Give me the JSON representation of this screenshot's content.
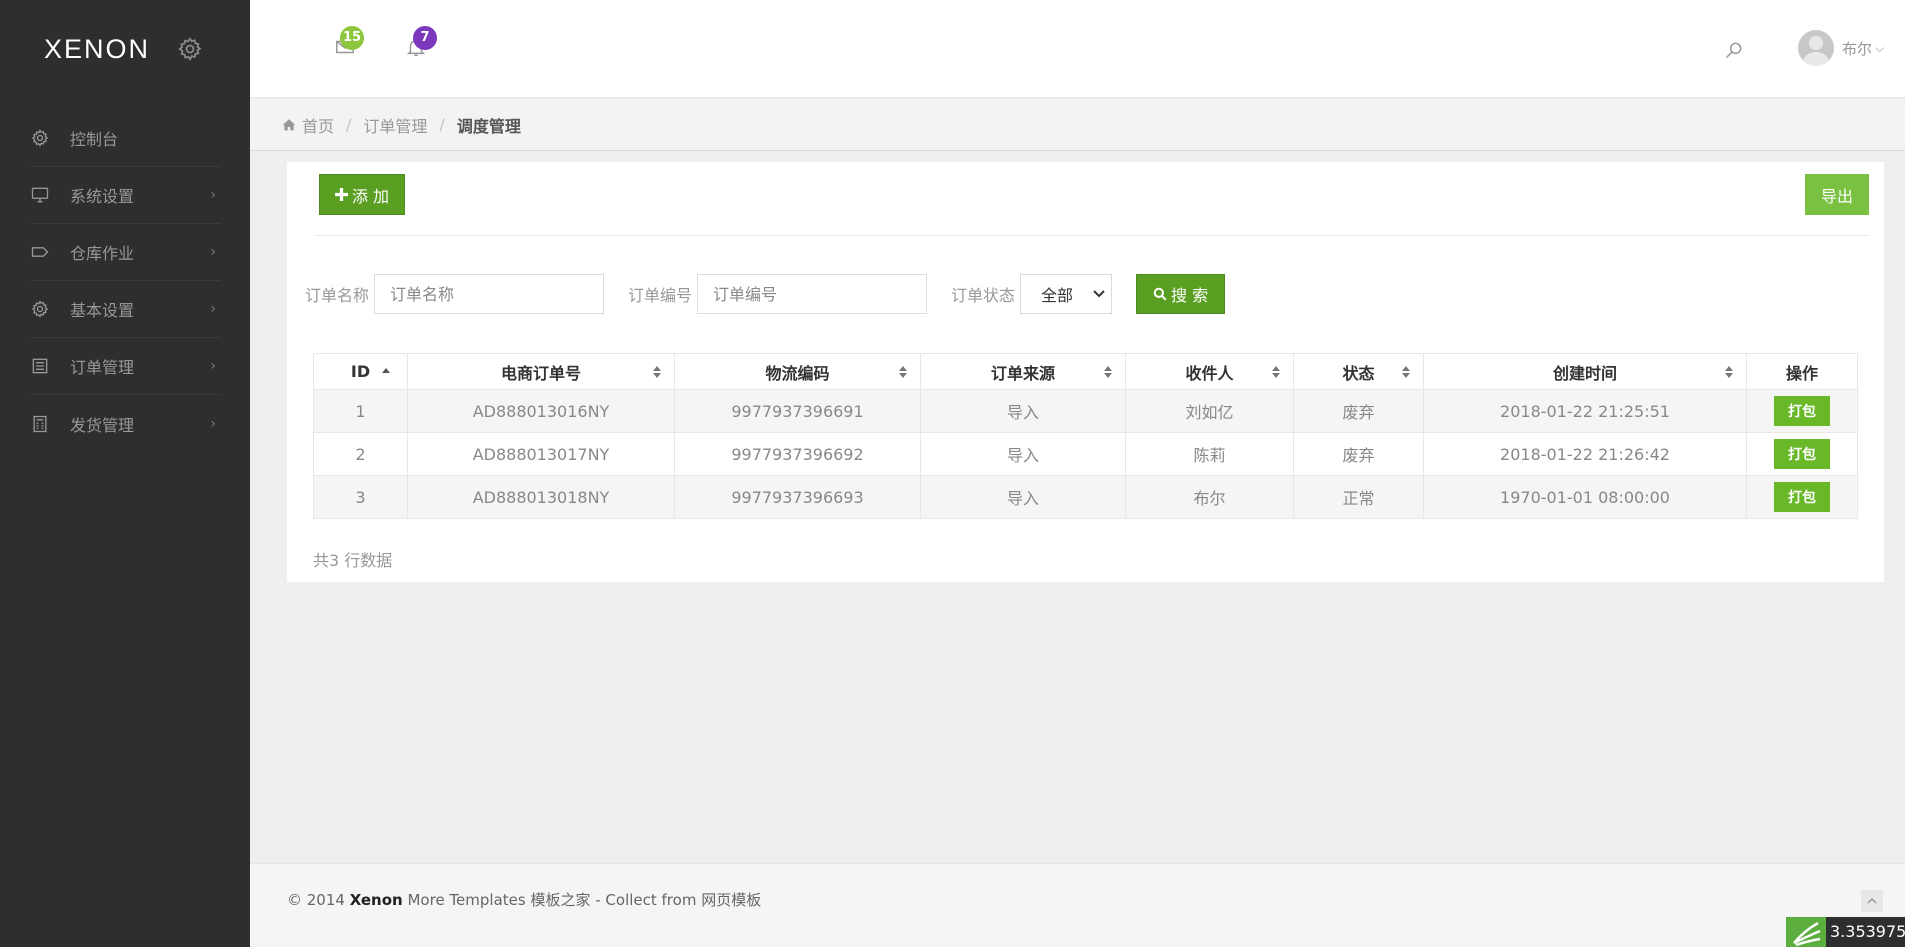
{
  "sidebar": {
    "logo": "XENON",
    "items": [
      {
        "label": "控制台",
        "icon": "gear-icon"
      },
      {
        "label": "系统设置",
        "icon": "monitor-icon"
      },
      {
        "label": "仓库作业",
        "icon": "tag-icon"
      },
      {
        "label": "基本设置",
        "icon": "gear-icon"
      },
      {
        "label": "订单管理",
        "icon": "list-icon"
      },
      {
        "label": "发货管理",
        "icon": "calculator-icon"
      }
    ]
  },
  "header": {
    "messages_count": "15",
    "notifications_count": "7",
    "user_name": "布尔"
  },
  "breadcrumb": {
    "home": "首页",
    "parent": "订单管理",
    "current": "调度管理"
  },
  "toolbar": {
    "add_label": "添 加",
    "export_label": "导出"
  },
  "filters": {
    "order_name_label": "订单名称",
    "order_name_placeholder": "订单名称",
    "order_no_label": "订单编号",
    "order_no_placeholder": "订单编号",
    "status_label": "订单状态",
    "status_value": "全部",
    "search_label": "搜 索"
  },
  "table": {
    "columns": [
      "ID",
      "电商订单号",
      "物流编码",
      "订单来源",
      "收件人",
      "状态",
      "创建时间",
      "操作"
    ],
    "rows": [
      {
        "id": "1",
        "order_no": "AD888013016NY",
        "logistics": "9977937396691",
        "source": "导入",
        "recipient": "刘如亿",
        "status": "废弃",
        "created": "2018-01-22 21:25:51",
        "action": "打包"
      },
      {
        "id": "2",
        "order_no": "AD888013017NY",
        "logistics": "9977937396692",
        "source": "导入",
        "recipient": "陈莉",
        "status": "废弃",
        "created": "2018-01-22 21:26:42",
        "action": "打包"
      },
      {
        "id": "3",
        "order_no": "AD888013018NY",
        "logistics": "9977937396693",
        "source": "导入",
        "recipient": "布尔",
        "status": "正常",
        "created": "1970-01-01 08:00:00",
        "action": "打包"
      }
    ],
    "count_text": "共3 行数据"
  },
  "footer": {
    "prefix": "© 2014 ",
    "brand": "Xenon",
    "suffix": " More Templates 模板之家 - Collect from 网页模板"
  },
  "stat_widget": {
    "value": "3.353975"
  },
  "colors": {
    "sidebar_bg": "#2c2e2f",
    "primary_green": "#68b828",
    "badge_green": "#8dc63f",
    "badge_purple": "#7c38bc"
  }
}
